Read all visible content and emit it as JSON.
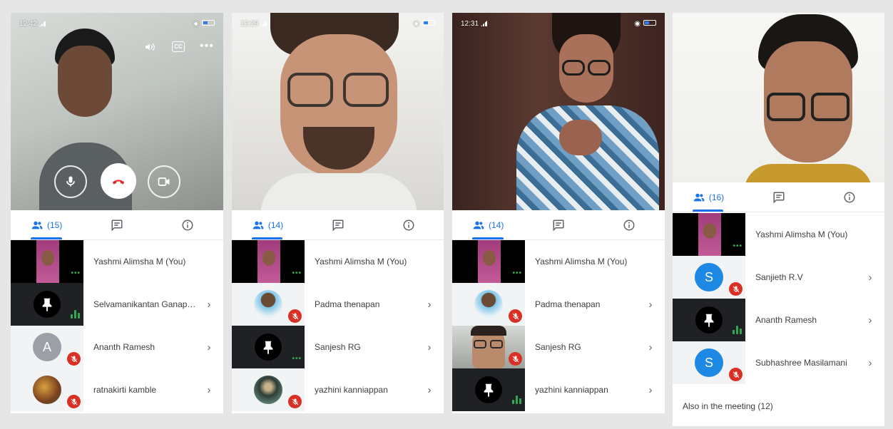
{
  "panels": [
    {
      "status_time": "12:42",
      "participant_count": "(15)",
      "participants": [
        {
          "name": "Yashmi Alimsha M (You)"
        },
        {
          "name": "Selvamanikantan Ganapat..."
        },
        {
          "name": "Ananth Ramesh",
          "initial": "A"
        },
        {
          "name": "ratnakirti kamble"
        }
      ]
    },
    {
      "status_time": "12:29",
      "participant_count": "(14)",
      "participants": [
        {
          "name": "Yashmi Alimsha M (You)"
        },
        {
          "name": "Padma thenapan"
        },
        {
          "name": "Sanjesh RG"
        },
        {
          "name": "yazhini kanniappan"
        }
      ]
    },
    {
      "status_time": "12:31",
      "participant_count": "(14)",
      "participants": [
        {
          "name": "Yashmi Alimsha M (You)"
        },
        {
          "name": "Padma thenapan"
        },
        {
          "name": "Sanjesh RG"
        },
        {
          "name": "yazhini kanniappan"
        }
      ]
    },
    {
      "participant_count": "(16)",
      "participants": [
        {
          "name": "Yashmi Alimsha M (You)"
        },
        {
          "name": "Sanjieth R.V",
          "initial": "S"
        },
        {
          "name": "Ananth Ramesh"
        },
        {
          "name": "Subhashree Masilamani",
          "initial": "S"
        }
      ],
      "also_in_meeting": "Also in the meeting (12)"
    }
  ],
  "icons": {
    "people": "people-icon",
    "chat": "chat-icon",
    "info": "info-icon",
    "mic": "mic-icon",
    "end_call": "end-call-icon",
    "camera": "camera-icon",
    "speaker": "speaker-icon",
    "captions": "captions-icon",
    "more": "more-icon",
    "mic_off": "mic-off-icon",
    "pin": "pin-icon",
    "chevron": "chevron-right-icon"
  },
  "captions_label": "CC",
  "colors": {
    "accent": "#1a73e8",
    "end_call": "#d93025",
    "mute": "#d93025",
    "speaking": "#34a853",
    "avatar_grey": "#9aa0a6",
    "avatar_blue": "#1e88e5"
  }
}
